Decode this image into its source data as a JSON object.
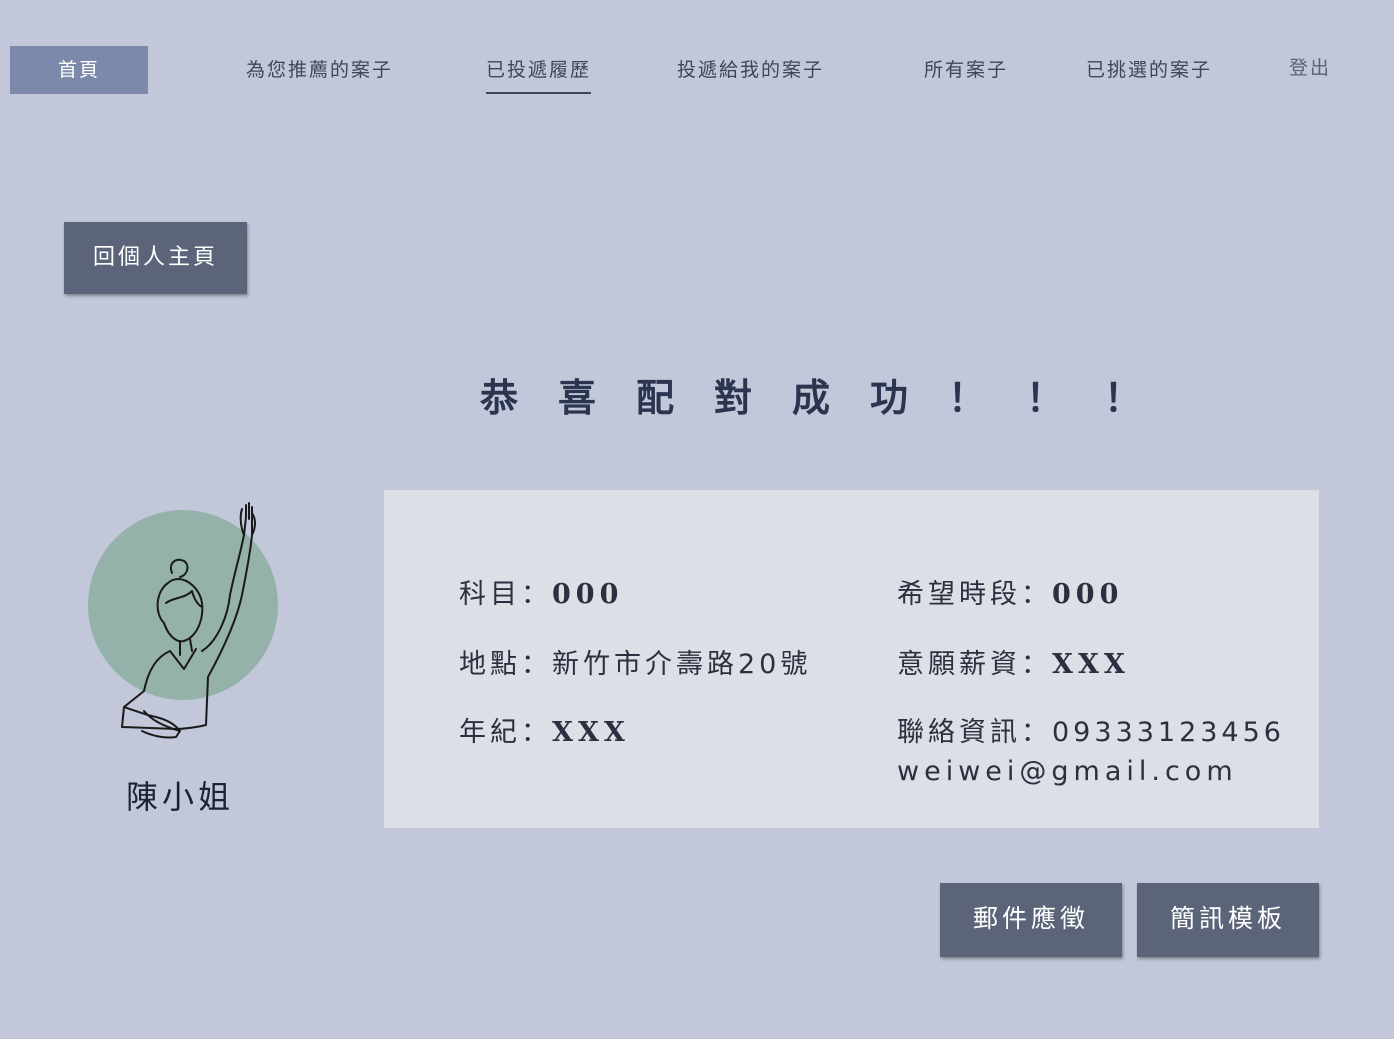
{
  "nav": {
    "home": "首頁",
    "recommended": "為您推薦的案子",
    "submitted": "已投遞履歷",
    "applied_to_me": "投遞給我的案子",
    "all_cases": "所有案子",
    "selected": "已挑選的案子",
    "logout": "登出"
  },
  "back_button": "回個人主頁",
  "headline": "恭喜配對成功！！！",
  "profile": {
    "name": "陳小姐",
    "avatar_icon": "person-raising-hand-icon",
    "avatar_circle_color": "#94b2aa"
  },
  "details": {
    "subject_label": "科目：",
    "subject_value": "000",
    "time_label": "希望時段：",
    "time_value": "000",
    "location_label": "地點：",
    "location_value": "新竹市介壽路20號",
    "salary_label": "意願薪資：",
    "salary_value": "XXX",
    "age_label": "年紀：",
    "age_value": "XXX",
    "contact_label": "聯絡資訊：",
    "contact_phone": "09333123456",
    "contact_email": "weiwei@gmail.com"
  },
  "actions": {
    "email_apply": "郵件應徵",
    "sms_template": "簡訊模板"
  },
  "colors": {
    "background": "#c2c8d9",
    "nav_home": "#7d89aa",
    "button": "#5c6479",
    "card": "#dcdfe5"
  }
}
